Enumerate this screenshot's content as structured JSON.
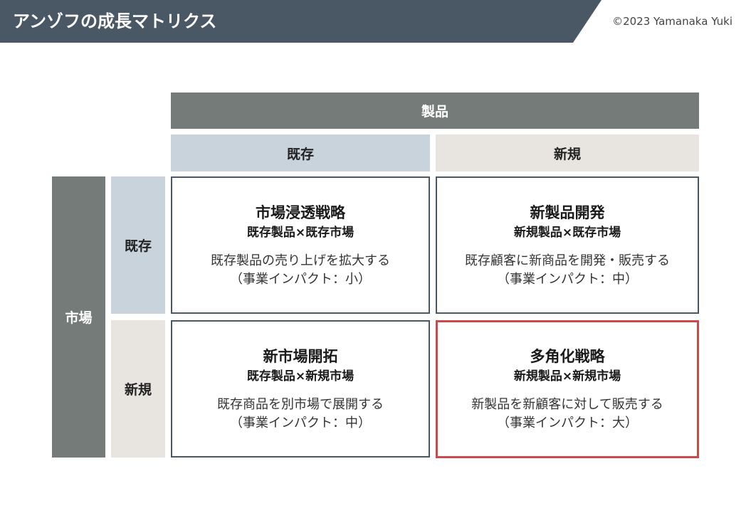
{
  "header": {
    "title": "アンゾフの成長マトリクス",
    "copyright": "©2023 Yamanaka Yuki"
  },
  "matrix": {
    "product_axis": "製品",
    "market_axis": "市場",
    "columns": [
      "既存",
      "新規"
    ],
    "rows": [
      "既存",
      "新規"
    ],
    "cells": [
      {
        "name": "市場浸透戦略",
        "combo": "既存製品×既存市場",
        "desc": "既存製品の売り上げを拡大する",
        "impact": "（事業インパクト：小）"
      },
      {
        "name": "新製品開発",
        "combo": "新規製品×既存市場",
        "desc": "既存顧客に新商品を開発・販売する",
        "impact": "（事業インパクト：中）"
      },
      {
        "name": "新市場開拓",
        "combo": "既存製品×新規市場",
        "desc": "既存商品を別市場で展開する",
        "impact": "（事業インパクト：中）"
      },
      {
        "name": "多角化戦略",
        "combo": "新規製品×新規市場",
        "desc": "新製品を新顧客に対して販売する",
        "impact": "（事業インパクト：大）"
      }
    ]
  },
  "colors": {
    "header_bg": "#4a5866",
    "axis_bg": "#747b78",
    "existing_bg": "#c8d3dc",
    "new_bg": "#e8e4df",
    "cell_border": "#4a5866",
    "highlight_border": "#cc4a4a"
  }
}
